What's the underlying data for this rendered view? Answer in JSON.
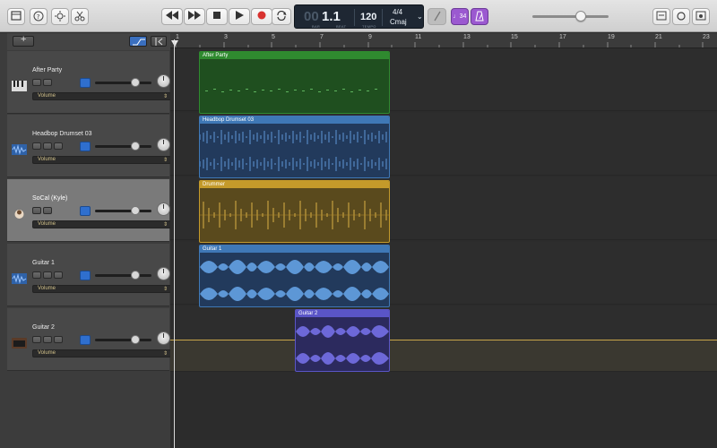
{
  "lcd": {
    "bar": "1.1",
    "bar_label": "BAR",
    "beat_label": "BEAT",
    "tempo": "120",
    "tempo_label": "TEMPO",
    "time_sig": "4/4",
    "key": "Cmaj"
  },
  "count_in": "♩34",
  "ruler_marks": [
    "1",
    "3",
    "5",
    "7",
    "9",
    "11",
    "13",
    "15",
    "17",
    "19",
    "21",
    "23"
  ],
  "tracks": [
    {
      "name": "After Party",
      "automation": "Volume",
      "icon": "keyboard-icon"
    },
    {
      "name": "Headbop Drumset 03",
      "automation": "Volume",
      "icon": "audio-waveform-icon"
    },
    {
      "name": "SoCal (Kyle)",
      "automation": "Volume",
      "icon": "drummer-icon"
    },
    {
      "name": "Guitar 1",
      "automation": "Volume",
      "icon": "audio-waveform-icon"
    },
    {
      "name": "Guitar 2",
      "automation": "Volume",
      "icon": "amp-icon"
    }
  ],
  "regions": [
    {
      "label": "After Party",
      "color": "#2f8a2f"
    },
    {
      "label": "Headbop Drumset 03",
      "color": "#3f78b6"
    },
    {
      "label": "Drummer",
      "color": "#c49a2a"
    },
    {
      "label": "Guitar 1",
      "color": "#3f78b6"
    },
    {
      "label": "Guitar 2",
      "color": "#5a55c7"
    }
  ],
  "colors": {
    "selected_track": "#7a7a7a",
    "record": "#d8322f",
    "accent": "#9b59d0"
  }
}
